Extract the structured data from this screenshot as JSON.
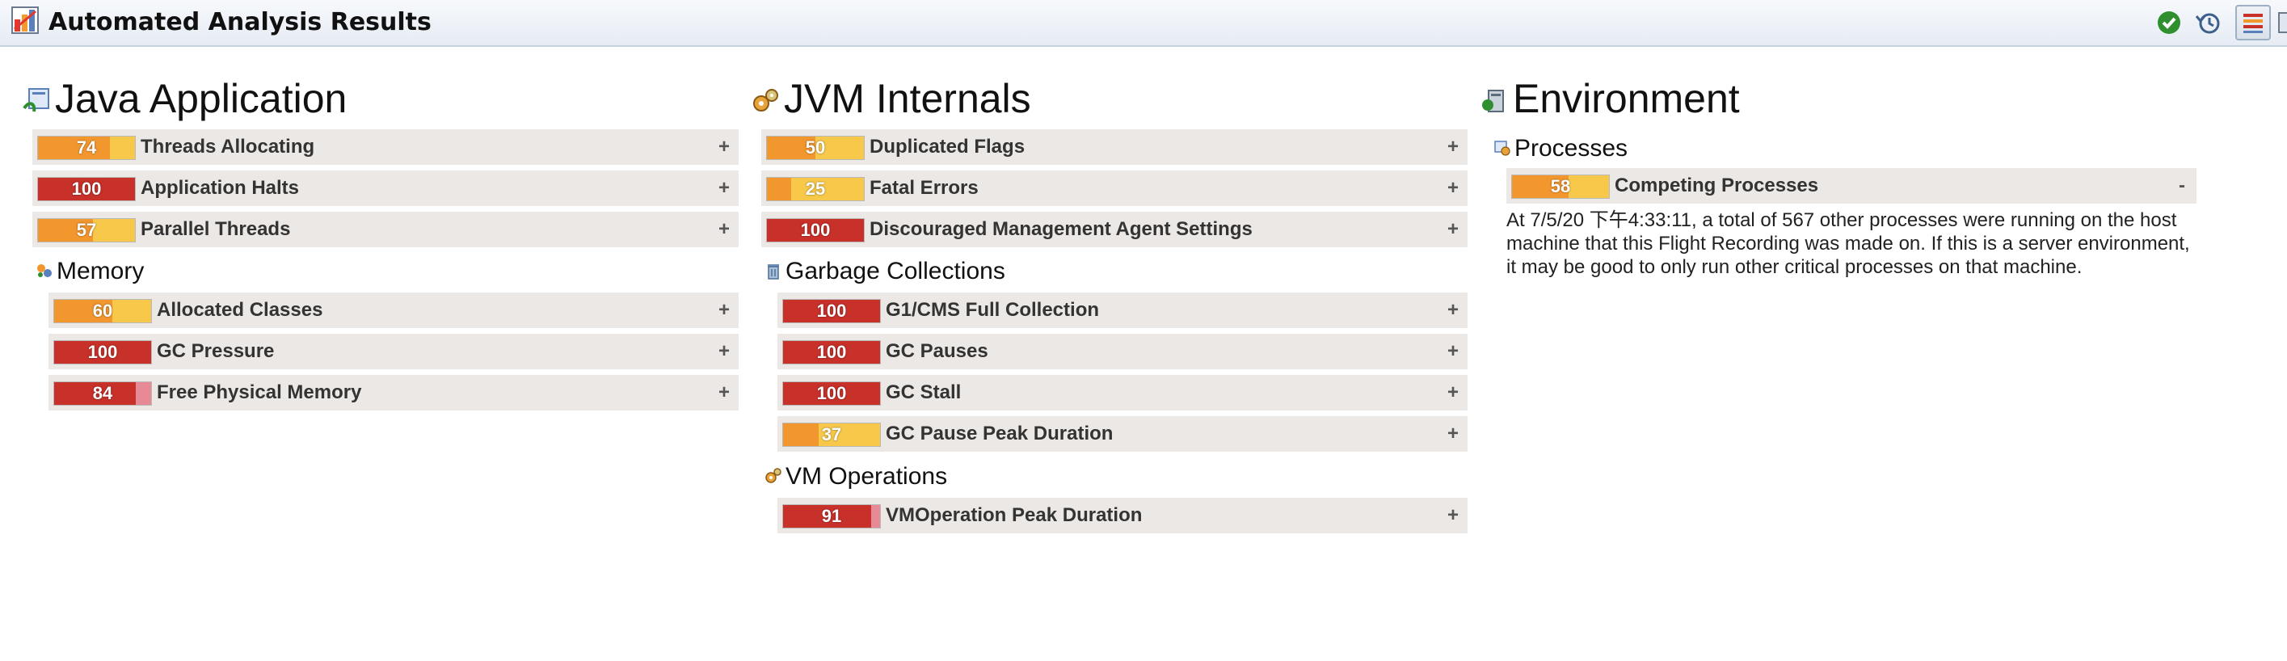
{
  "title": "Automated Analysis Results",
  "toolbar": {
    "ok_icon": "check-circle-icon",
    "history_icon": "history-icon",
    "table_view_icon": "table-view-icon"
  },
  "colors": {
    "red": "#c8302a",
    "red_remainder": "#e88a95",
    "orange": "#f2962e",
    "yellow": "#f7c84a"
  },
  "columns": [
    {
      "title": "Java Application",
      "icon": "java-application-icon",
      "rules": [
        {
          "name": "Threads Allocating",
          "score": 74,
          "expander": "+"
        },
        {
          "name": "Application Halts",
          "score": 100,
          "expander": "+"
        },
        {
          "name": "Parallel Threads",
          "score": 57,
          "expander": "+"
        }
      ],
      "groups": [
        {
          "title": "Memory",
          "icon": "memory-icon",
          "rules": [
            {
              "name": "Allocated Classes",
              "score": 60,
              "expander": "+"
            },
            {
              "name": "GC Pressure",
              "score": 100,
              "expander": "+"
            },
            {
              "name": "Free Physical Memory",
              "score": 84,
              "expander": "+"
            }
          ]
        }
      ]
    },
    {
      "title": "JVM Internals",
      "icon": "jvm-internals-icon",
      "rules": [
        {
          "name": "Duplicated Flags",
          "score": 50,
          "expander": "+"
        },
        {
          "name": "Fatal Errors",
          "score": 25,
          "expander": "+"
        },
        {
          "name": "Discouraged Management Agent Settings",
          "score": 100,
          "expander": "+"
        }
      ],
      "groups": [
        {
          "title": "Garbage Collections",
          "icon": "trash-icon",
          "rules": [
            {
              "name": "G1/CMS Full Collection",
              "score": 100,
              "expander": "+"
            },
            {
              "name": "GC Pauses",
              "score": 100,
              "expander": "+"
            },
            {
              "name": "GC Stall",
              "score": 100,
              "expander": "+"
            },
            {
              "name": "GC Pause Peak Duration",
              "score": 37,
              "expander": "+"
            }
          ]
        },
        {
          "title": "VM Operations",
          "icon": "vm-operations-icon",
          "rules": [
            {
              "name": "VMOperation Peak Duration",
              "score": 91,
              "expander": "+"
            }
          ]
        }
      ]
    },
    {
      "title": "Environment",
      "icon": "environment-icon",
      "rules": [],
      "groups": [
        {
          "title": "Processes",
          "icon": "processes-icon",
          "rules": [
            {
              "name": "Competing Processes",
              "score": 58,
              "expander": "-",
              "description": "At 7/5/20 下午4:33:11, a total of 567 other processes were running on the host machine that this Flight Recording was made on. If this is a server environment, it may be good to only run other critical processes on that machine."
            }
          ]
        }
      ]
    }
  ]
}
